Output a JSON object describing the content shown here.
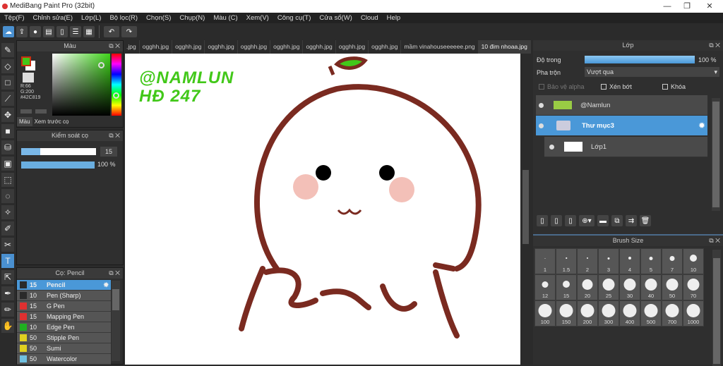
{
  "window": {
    "title": "MediBang Paint Pro (32bit)",
    "min": "—",
    "max": "❐",
    "close": "✕"
  },
  "menu": [
    "Tệp(F)",
    "Chỉnh sửa(E)",
    "Lớp(L)",
    "Bộ lọc(R)",
    "Chọn(S)",
    "Chụp(N)",
    "Màu (C)",
    "Xem(V)",
    "Công cụ(T)",
    "Cửa sổ(W)",
    "Cloud",
    "Help"
  ],
  "color_panel": {
    "title": "Màu",
    "r": "R:66",
    "g": "G:200",
    "hex": "#42C819",
    "tabs": [
      "Màu",
      "Xem trước cọ"
    ],
    "fg": "#42C819"
  },
  "brush_control": {
    "title": "Kiểm soát cọ",
    "size": "15",
    "opacity": "100 %",
    "size_fraction": 0.25,
    "opacity_fraction": 1.0
  },
  "brush_panel": {
    "title": "Cọ: Pencil",
    "items": [
      {
        "size": "15",
        "name": "Pencil",
        "color": "#2a2a2a"
      },
      {
        "size": "10",
        "name": "Pen (Sharp)",
        "color": "#2a2a2a"
      },
      {
        "size": "15",
        "name": "G Pen",
        "color": "#e03030"
      },
      {
        "size": "15",
        "name": "Mapping Pen",
        "color": "#e03030"
      },
      {
        "size": "10",
        "name": "Edge Pen",
        "color": "#20b020"
      },
      {
        "size": "50",
        "name": "Stipple Pen",
        "color": "#e0d020"
      },
      {
        "size": "50",
        "name": "Sumi",
        "color": "#e0d020"
      },
      {
        "size": "50",
        "name": "Watercolor",
        "color": "#70c0e0"
      }
    ]
  },
  "tabs": [
    ".jpg",
    "ogghh.jpg",
    "ogghh.jpg",
    "ogghh.jpg",
    "ogghh.jpg",
    "ogghh.jpg",
    "ogghh.jpg",
    "ogghh.jpg",
    "ogghh.jpg",
    "mầm vinahouseeeeee.png",
    "10 đim nhoaa.jpg"
  ],
  "canvas": {
    "line1": "@NAMLUN",
    "line2": "HĐ 247"
  },
  "layer_panel": {
    "title": "Lớp",
    "opacity_label": "Độ trong",
    "opacity": "100 %",
    "blend_label": "Pha trộn",
    "blend": "Vượt qua",
    "protect_alpha": "Bảo vệ alpha",
    "clip": "Xén bớt",
    "lock": "Khóa",
    "layers": [
      {
        "name": "@Namlun"
      },
      {
        "name": "Thư mục3"
      },
      {
        "name": "Lớp1"
      }
    ]
  },
  "brush_size": {
    "title": "Brush Size",
    "sizes": [
      "1",
      "1.5",
      "2",
      "3",
      "4",
      "5",
      "7",
      "10",
      "12",
      "15",
      "20",
      "25",
      "30",
      "40",
      "50",
      "70",
      "100",
      "150",
      "200",
      "300",
      "400",
      "500",
      "700",
      "1000"
    ]
  }
}
